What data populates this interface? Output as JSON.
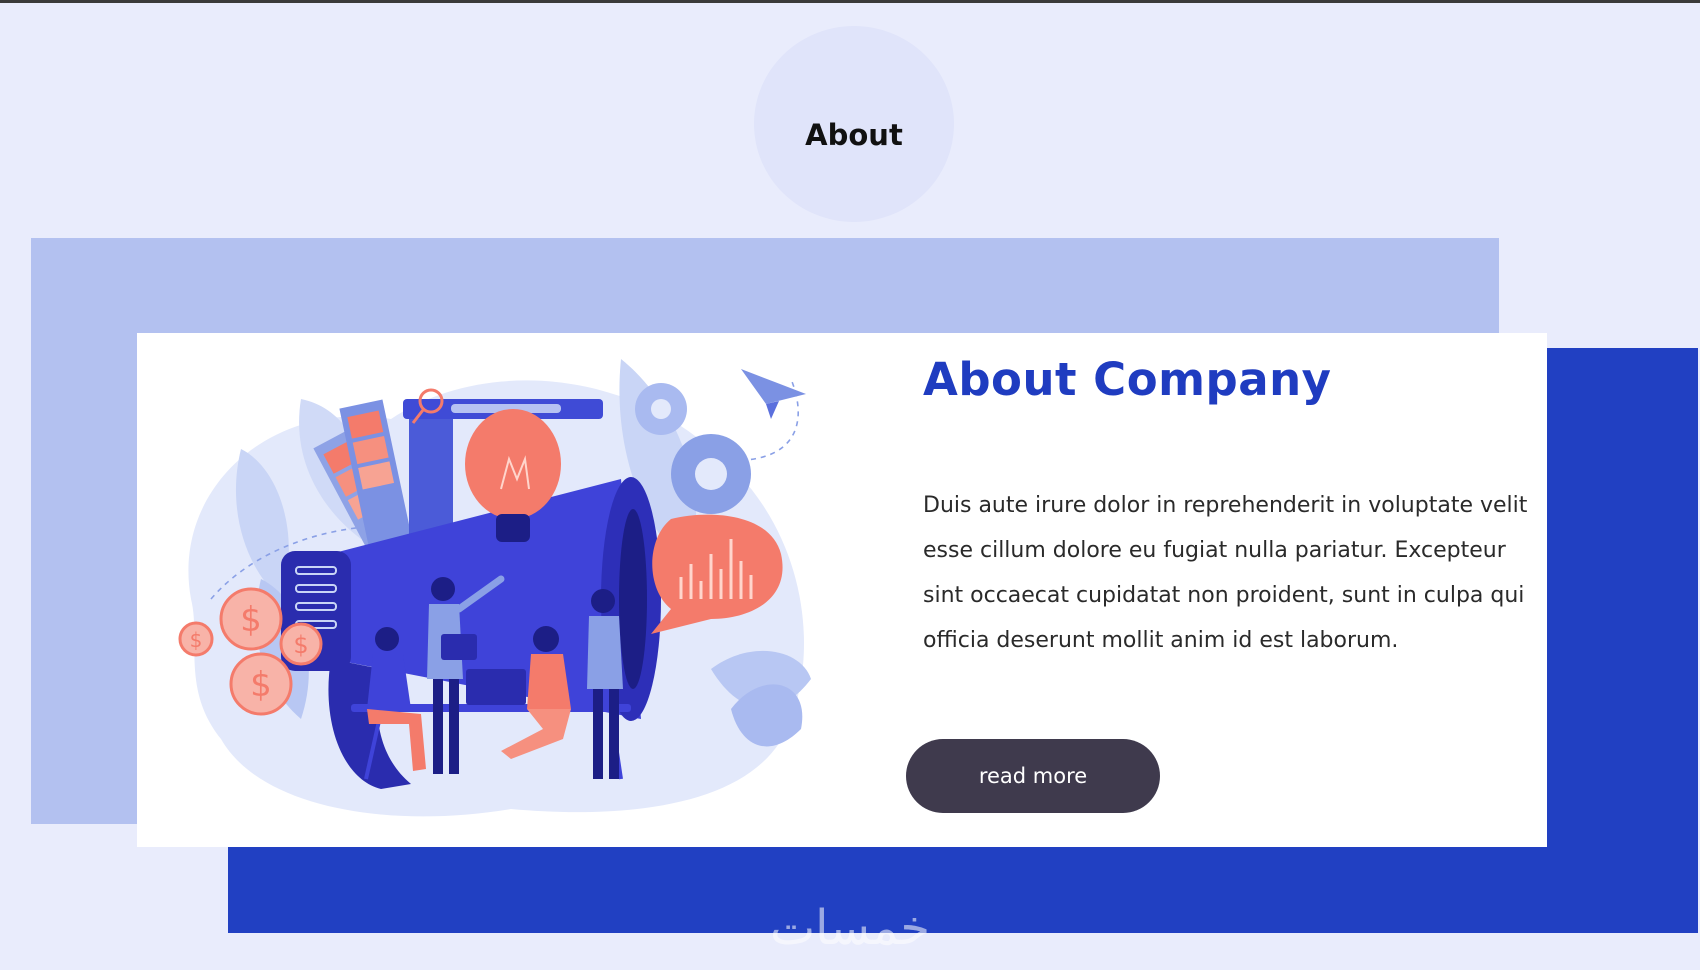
{
  "section": {
    "heading": "About"
  },
  "card": {
    "title": "About Company",
    "body": "Duis aute irure dolor in reprehenderit in voluptate velit esse cillum dolore eu fugiat nulla pariatur. Excepteur sint occaecat cupidatat non proident, sunt in culpa qui officia deserunt mollit anim id est laborum.",
    "button_label": "read more"
  },
  "illustration": {
    "icon": "team-marketing-illustration"
  },
  "watermark": {
    "text": "خمسات"
  },
  "colors": {
    "page_background": "#e9ecfc",
    "accent_dark_blue": "#2140c2",
    "accent_light_blue": "#b3c1f0",
    "title_blue": "#1f3cc0",
    "button_background": "#3f3a4d",
    "illustration_coral": "#f47b6b"
  }
}
